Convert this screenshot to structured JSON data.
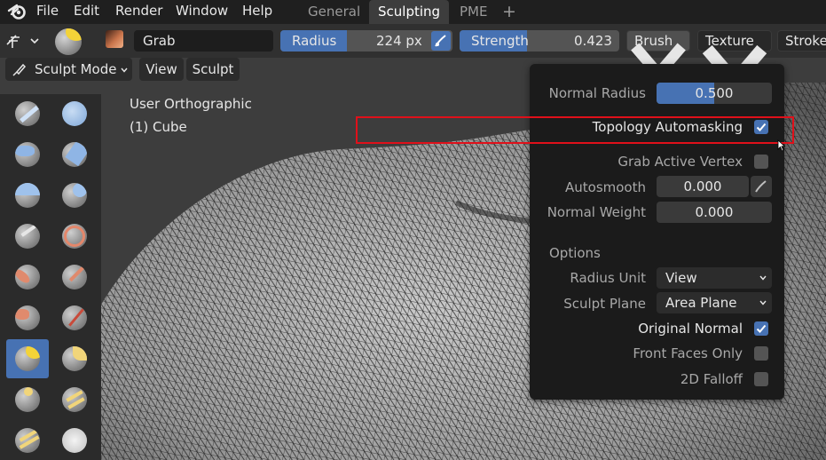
{
  "menubar": {
    "logo_icon": "blender-logo-icon",
    "items": [
      "File",
      "Edit",
      "Render",
      "Window",
      "Help"
    ],
    "workspace_tabs": [
      "General",
      "Sculpting",
      "PME"
    ],
    "active_tab": "Sculpting",
    "add_tab_label": "+"
  },
  "toolheader": {
    "brush_name": "Grab",
    "radius_label": "Radius",
    "radius_value": "224 px",
    "strength_label": "Strength",
    "strength_value": "0.423",
    "brush_menu": "Brush",
    "texture_menu": "Texture",
    "stroke_menu": "Stroke"
  },
  "modeheader": {
    "mode": "Sculpt Mode",
    "view": "View",
    "sculpt": "Sculpt"
  },
  "viewport": {
    "view_name": "User Orthographic",
    "object_name": "(1) Cube"
  },
  "popover": {
    "normal_radius_label": "Normal Radius",
    "normal_radius_value": "0.500",
    "normal_radius_fill": 0.5,
    "topology_automasking_label": "Topology Automasking",
    "topology_automasking_checked": true,
    "grab_active_vertex_label": "Grab Active Vertex",
    "grab_active_vertex_checked": false,
    "autosmooth_label": "Autosmooth",
    "autosmooth_value": "0.000",
    "normal_weight_label": "Normal Weight",
    "normal_weight_value": "0.000",
    "options_heading": "Options",
    "radius_unit_label": "Radius Unit",
    "radius_unit_value": "View",
    "sculpt_plane_label": "Sculpt Plane",
    "sculpt_plane_value": "Area Plane",
    "original_normal_label": "Original Normal",
    "original_normal_checked": true,
    "front_faces_only_label": "Front Faces Only",
    "front_faces_only_checked": false,
    "falloff_2d_label": "2D Falloff",
    "falloff_2d_checked": false
  },
  "colors": {
    "accent_blue": "#4772b3",
    "highlight_red": "#e0101a"
  }
}
